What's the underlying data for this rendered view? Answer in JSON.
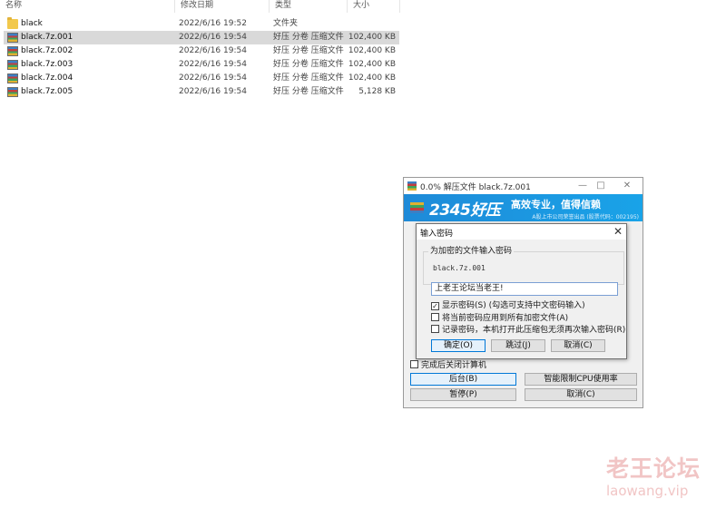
{
  "explorer": {
    "columns": [
      "名称",
      "修改日期",
      "类型",
      "大小"
    ],
    "files": [
      {
        "name": "black",
        "date": "2022/6/16 19:52",
        "type": "文件夹",
        "size": "",
        "icon": "folder-icon",
        "selected": false
      },
      {
        "name": "black.7z.001",
        "date": "2022/6/16 19:54",
        "type": "好压 分卷 压缩文件",
        "size": "102,400 KB",
        "icon": "archive-icon",
        "selected": true
      },
      {
        "name": "black.7z.002",
        "date": "2022/6/16 19:54",
        "type": "好压 分卷 压缩文件",
        "size": "102,400 KB",
        "icon": "archive-icon",
        "selected": false
      },
      {
        "name": "black.7z.003",
        "date": "2022/6/16 19:54",
        "type": "好压 分卷 压缩文件",
        "size": "102,400 KB",
        "icon": "archive-icon",
        "selected": false
      },
      {
        "name": "black.7z.004",
        "date": "2022/6/16 19:54",
        "type": "好压 分卷 压缩文件",
        "size": "102,400 KB",
        "icon": "archive-icon",
        "selected": false
      },
      {
        "name": "black.7z.005",
        "date": "2022/6/16 19:54",
        "type": "好压 分卷 压缩文件",
        "size": "5,128 KB",
        "icon": "archive-icon",
        "selected": false
      }
    ]
  },
  "extract_window": {
    "title": "0.0% 解压文件 black.7z.001",
    "banner_logo": "2345好压",
    "banner_slogan": "高效专业，值得信赖",
    "banner_sub": "A股上市公司荣誉出品 (股票代码：002195)",
    "shutdown_label": "完成后关闭计算机",
    "buttons": {
      "background": "后台(B)",
      "cpu_limit": "智能限制CPU使用率",
      "pause": "暂停(P)",
      "cancel": "取消(C)"
    }
  },
  "password_dialog": {
    "title": "输入密码",
    "group_label": "为加密的文件输入密码",
    "file_name": "black.7z.001",
    "password_value": "上老王论坛当老王!",
    "options": {
      "show_password": "显示密码(S)  (勾选可支持中文密码输入)",
      "apply_all": "将当前密码应用到所有加密文件(A)",
      "remember": "记录密码，本机打开此压缩包无须再次输入密码(R)"
    },
    "checked": {
      "show_password": true,
      "apply_all": false,
      "remember": false
    },
    "buttons": {
      "ok": "确定(O)",
      "skip": "跳过(J)",
      "cancel": "取消(C)"
    }
  },
  "watermark": {
    "cn": "老王论坛",
    "en": "laowang.vip"
  },
  "colors": {
    "accent": "#0078d7",
    "banner": "#1e8ad8",
    "selection": "#d9d9d9",
    "watermark": "#f1c5c5"
  }
}
